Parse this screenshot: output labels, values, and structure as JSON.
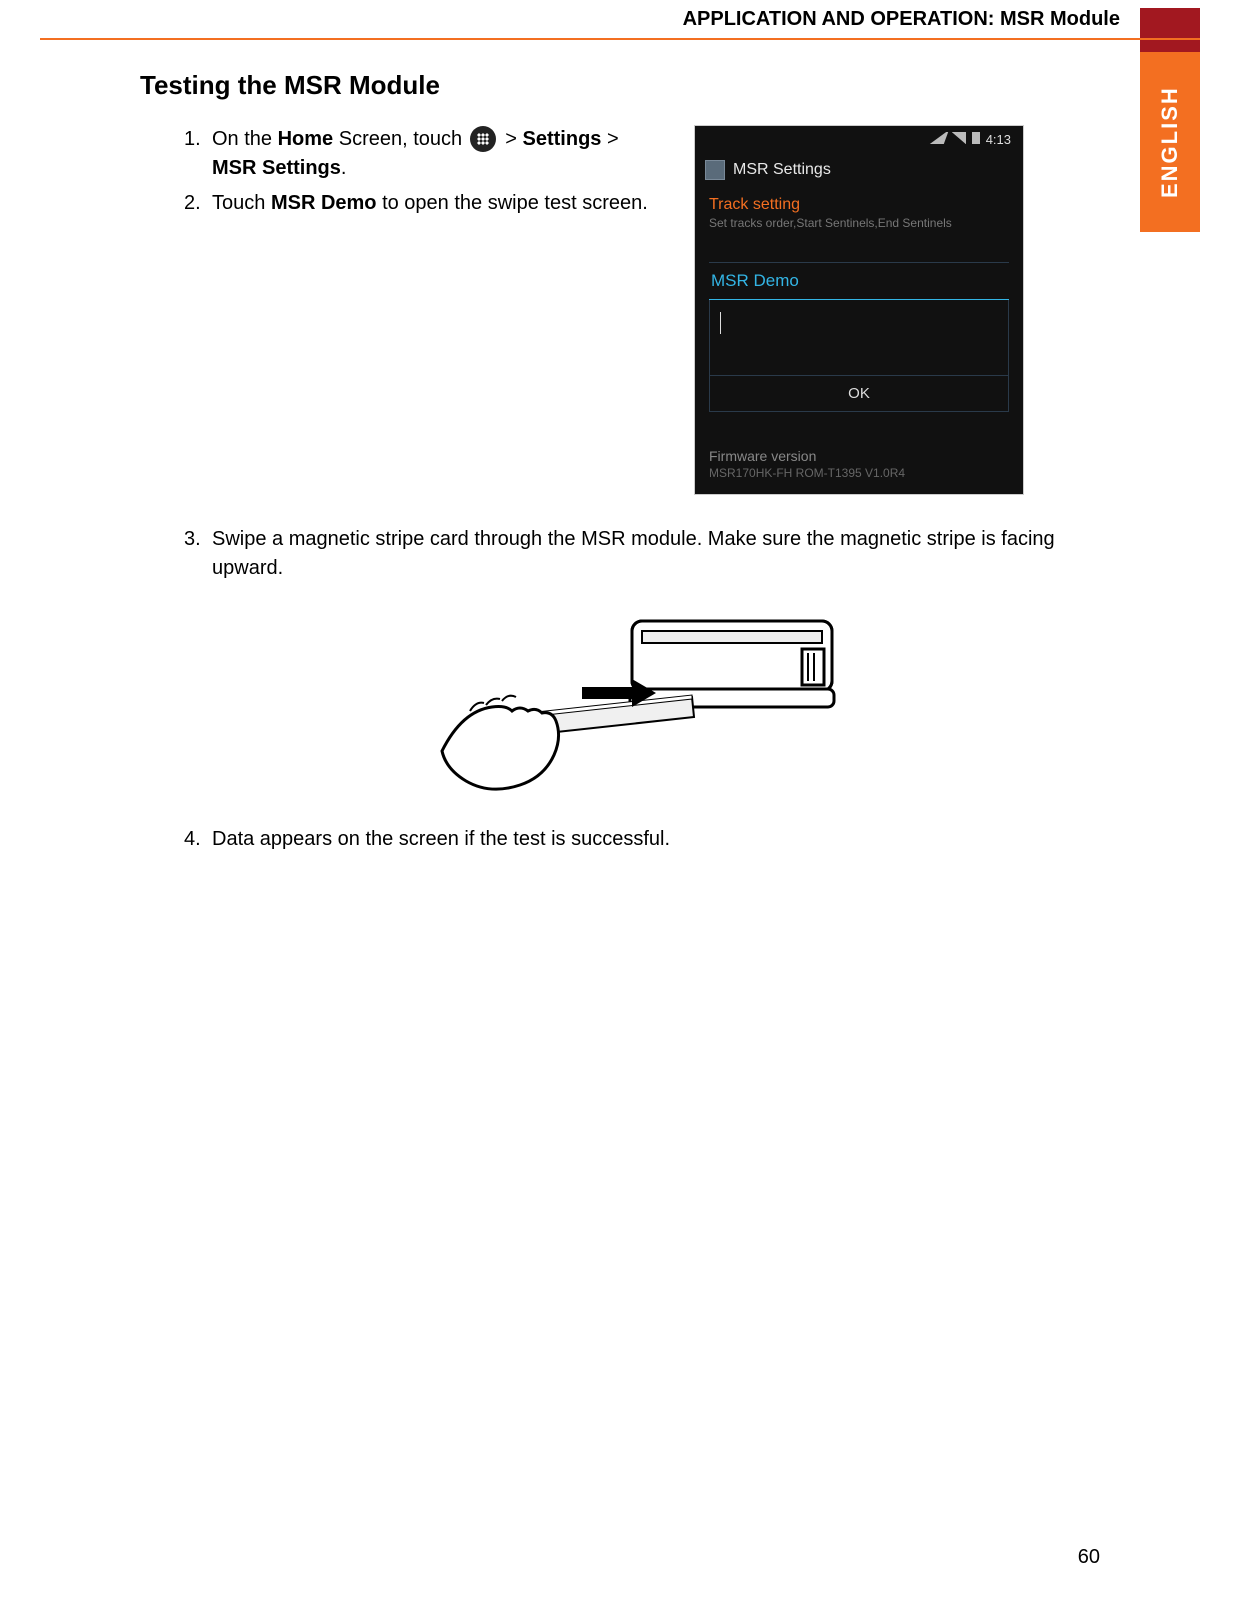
{
  "header": {
    "title": "APPLICATION AND OPERATION: MSR Module",
    "side_tab": "ENGLISH"
  },
  "section_title": "Testing the MSR Module",
  "steps": {
    "s1": {
      "num": "1.",
      "pre": "On the ",
      "home": "Home",
      "mid": " Screen, touch ",
      "gt1": "  > ",
      "settings": "Settings",
      "gt2": " > ",
      "msr_settings": "MSR Settings",
      "end": "."
    },
    "s2": {
      "num": "2.",
      "pre": "Touch ",
      "msr_demo": "MSR Demo",
      "post": " to open the swipe test screen."
    },
    "s3": {
      "num": "3.",
      "text": "Swipe a magnetic stripe card through the MSR module. Make sure the magnetic stripe is facing upward."
    },
    "s4": {
      "num": "4.",
      "text": "Data appears on the screen if the test is successful."
    }
  },
  "phone": {
    "time": "4:13",
    "title": "MSR Settings",
    "track_heading": "Track setting",
    "track_sub": "Set tracks order,Start Sentinels,End Sentinels",
    "demo_title": "MSR Demo",
    "ok": "OK",
    "fw_heading": "Firmware version",
    "fw_value": "MSR170HK-FH ROM-T1395 V1.0R4"
  },
  "page_number": "60"
}
